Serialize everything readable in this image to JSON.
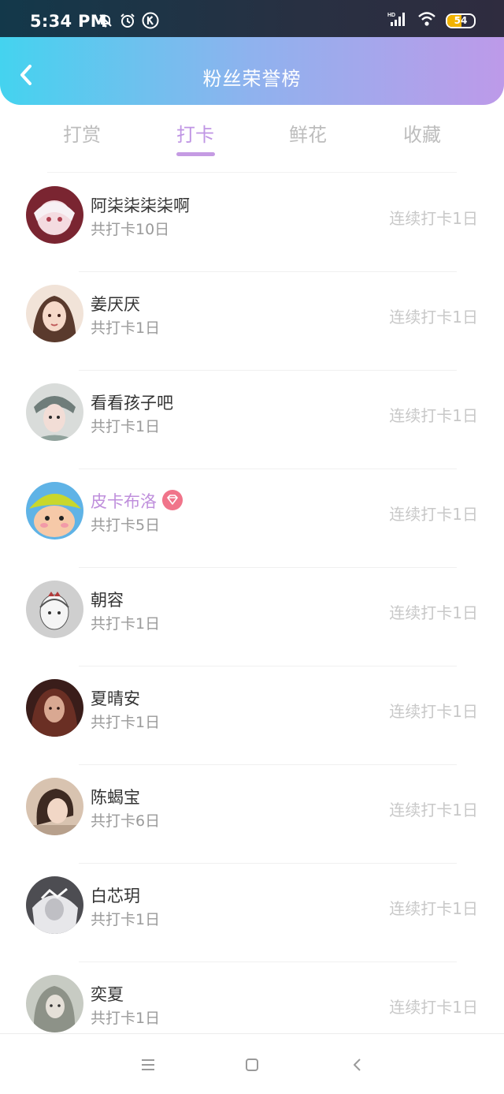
{
  "status_bar": {
    "time": "5:34 PM",
    "icons": [
      "mute-bell-icon",
      "alarm-icon",
      "k-app-icon",
      "hd-signal-icon",
      "wifi-icon",
      "battery-icon"
    ],
    "battery_level": "54",
    "battery_fraction": 0.54
  },
  "header": {
    "title": "粉丝荣誉榜",
    "back_icon": "chevron-left-icon",
    "gradient": [
      "#44d3ef",
      "#bd9ae9"
    ]
  },
  "tabs": [
    {
      "label": "打赏",
      "active": false
    },
    {
      "label": "打卡",
      "active": true
    },
    {
      "label": "鲜花",
      "active": false
    },
    {
      "label": "收藏",
      "active": false
    }
  ],
  "colors": {
    "accent": "#c59be3",
    "vip_name": "#bf8fdc",
    "vip_badge": "#f0748a",
    "muted_text": "#9a9a9a",
    "streak_text": "#c8c8c8"
  },
  "fans": [
    {
      "name": "阿柒柒柒柒啊",
      "total": "共打卡10日",
      "streak": "连续打卡1日",
      "vip": false
    },
    {
      "name": "姜厌厌",
      "total": "共打卡1日",
      "streak": "连续打卡1日",
      "vip": false
    },
    {
      "name": "看看孩子吧",
      "total": "共打卡1日",
      "streak": "连续打卡1日",
      "vip": false
    },
    {
      "name": "皮卡布洛",
      "total": "共打卡5日",
      "streak": "连续打卡1日",
      "vip": true
    },
    {
      "name": "朝容",
      "total": "共打卡1日",
      "streak": "连续打卡1日",
      "vip": false
    },
    {
      "name": "夏晴安",
      "total": "共打卡1日",
      "streak": "连续打卡1日",
      "vip": false
    },
    {
      "name": "陈蝎宝",
      "total": "共打卡6日",
      "streak": "连续打卡1日",
      "vip": false
    },
    {
      "name": "白芯玥",
      "total": "共打卡1日",
      "streak": "连续打卡1日",
      "vip": false
    },
    {
      "name": "奕夏",
      "total": "共打卡1日",
      "streak": "连续打卡1日",
      "vip": false
    }
  ],
  "system_nav": {
    "icons": [
      "menu-icon",
      "home-square-icon",
      "back-triangle-icon"
    ]
  }
}
